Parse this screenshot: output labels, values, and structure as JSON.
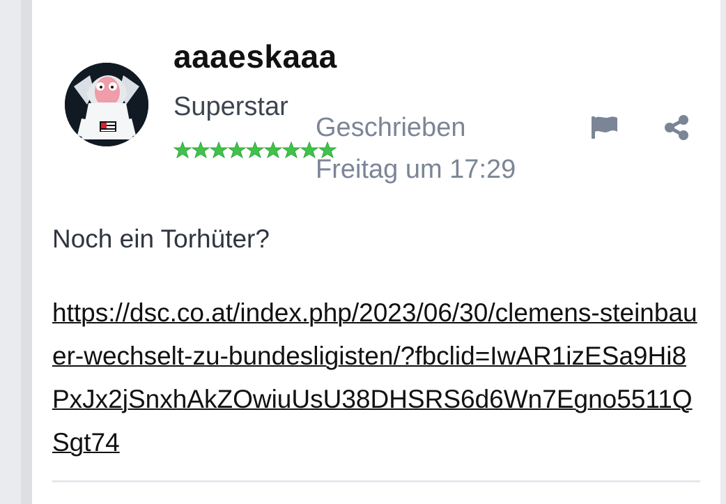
{
  "post": {
    "author": {
      "name": "aaaeskaaa",
      "rank": "Superstar",
      "stars": 9
    },
    "meta": {
      "label": "Geschrieben",
      "date": "Freitag um 17:29"
    },
    "actions": {
      "flag_icon": "flag-icon",
      "share_icon": "share-icon"
    },
    "content": {
      "message": "Noch ein Torhüter?",
      "link": "https://dsc.co.at/index.php/2023/06/30/clemens-steinbauer-wechselt-zu-bundesligisten/?fbclid=IwAR1izESa9Hi8PxJx2jSnxhAkZOwiuUsU38DHSRS6d6Wn7Egno5511QSgt74"
    },
    "colors": {
      "page_background": "#ebedf0",
      "card_background": "#ffffff",
      "muted_text": "#7b8596",
      "star_green": "#41c24b"
    }
  }
}
